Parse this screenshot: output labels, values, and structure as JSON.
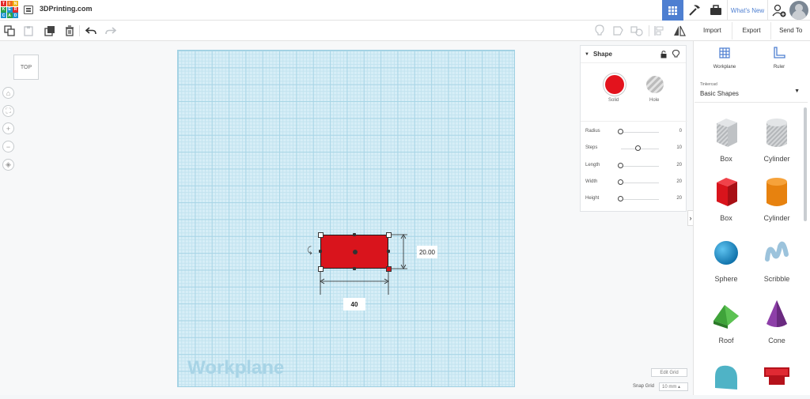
{
  "app": {
    "logo_letters": [
      "T",
      "I",
      "N",
      "K",
      "E",
      "R",
      "C",
      "A",
      "D"
    ],
    "document_title": "3DPrinting.com",
    "whats_new": "What's New"
  },
  "right_toolbar": {
    "import": "Import",
    "export": "Export",
    "send_to": "Send To"
  },
  "canvas": {
    "view_cube_label": "TOP",
    "workplane_label": "Workplane",
    "dimension_height": "20.00",
    "dimension_width": "40",
    "edit_grid": "Edit Grid",
    "snap_grid_label": "Snap Grid",
    "snap_grid_value": "10 mm ▴"
  },
  "inspector": {
    "title": "Shape",
    "solid_label": "Solid",
    "hole_label": "Hole",
    "properties": [
      {
        "name": "Radius",
        "value": "0",
        "level": 0.0
      },
      {
        "name": "Steps",
        "value": "10",
        "level": 0.45
      },
      {
        "name": "Length",
        "value": "20",
        "level": 0.0
      },
      {
        "name": "Width",
        "value": "20",
        "level": 0.0
      },
      {
        "name": "Height",
        "value": "20",
        "level": 0.0
      }
    ]
  },
  "shapes_panel": {
    "workplane_tool": "Workplane",
    "ruler_tool": "Ruler",
    "library_source": "Tinkercad",
    "library_name": "Basic Shapes",
    "shapes": [
      "Box",
      "Cylinder",
      "Box",
      "Cylinder",
      "Sphere",
      "Scribble",
      "Roof",
      "Cone",
      "",
      ""
    ]
  },
  "colors": {
    "accent": "#4e7fd1",
    "solid_red": "#d9141c",
    "workplane_blue": "#d7eef7"
  }
}
